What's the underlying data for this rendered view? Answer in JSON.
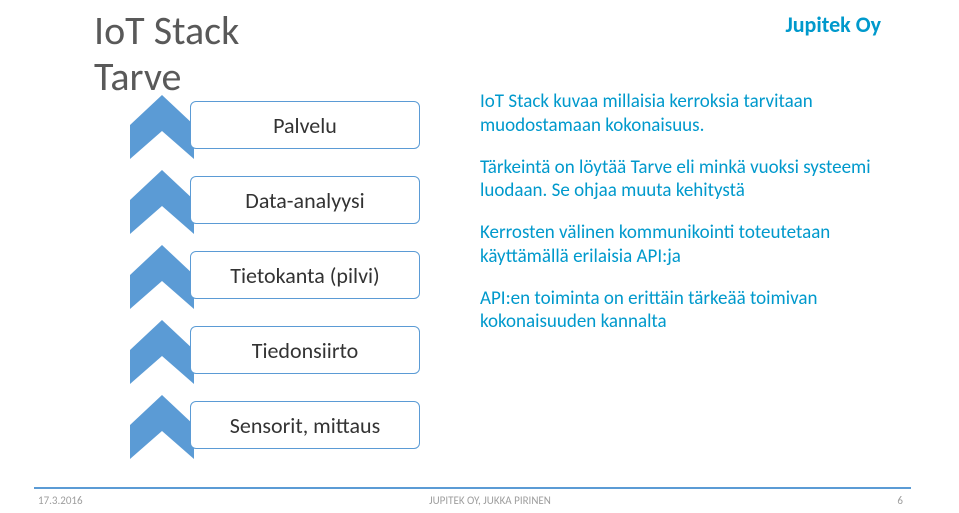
{
  "brand": "Jupitek Oy",
  "title": {
    "line1": "IoT Stack",
    "line2": "Tarve"
  },
  "stack_layers": [
    {
      "label": "Palvelu"
    },
    {
      "label": "Data-analyysi"
    },
    {
      "label": "Tietokanta (pilvi)"
    },
    {
      "label": "Tiedonsiirto"
    },
    {
      "label": "Sensorit, mittaus"
    }
  ],
  "paragraphs": [
    "IoT Stack kuvaa millaisia kerroksia tarvitaan muodostamaan kokonaisuus.",
    "Tärkeintä on löytää Tarve eli minkä vuoksi systeemi luodaan. Se ohjaa muuta kehitystä",
    "Kerrosten välinen kommunikointi toteutetaan käyttämällä erilaisia API:ja",
    "API:en toiminta on erittäin tärkeää toimivan kokonaisuuden kannalta"
  ],
  "footer": {
    "date": "17.3.2016",
    "center": "JUPITEK OY, JUKKA PIRINEN",
    "page": "6"
  },
  "colors": {
    "accent": "#5b9bd5",
    "brand": "#0099cc"
  }
}
